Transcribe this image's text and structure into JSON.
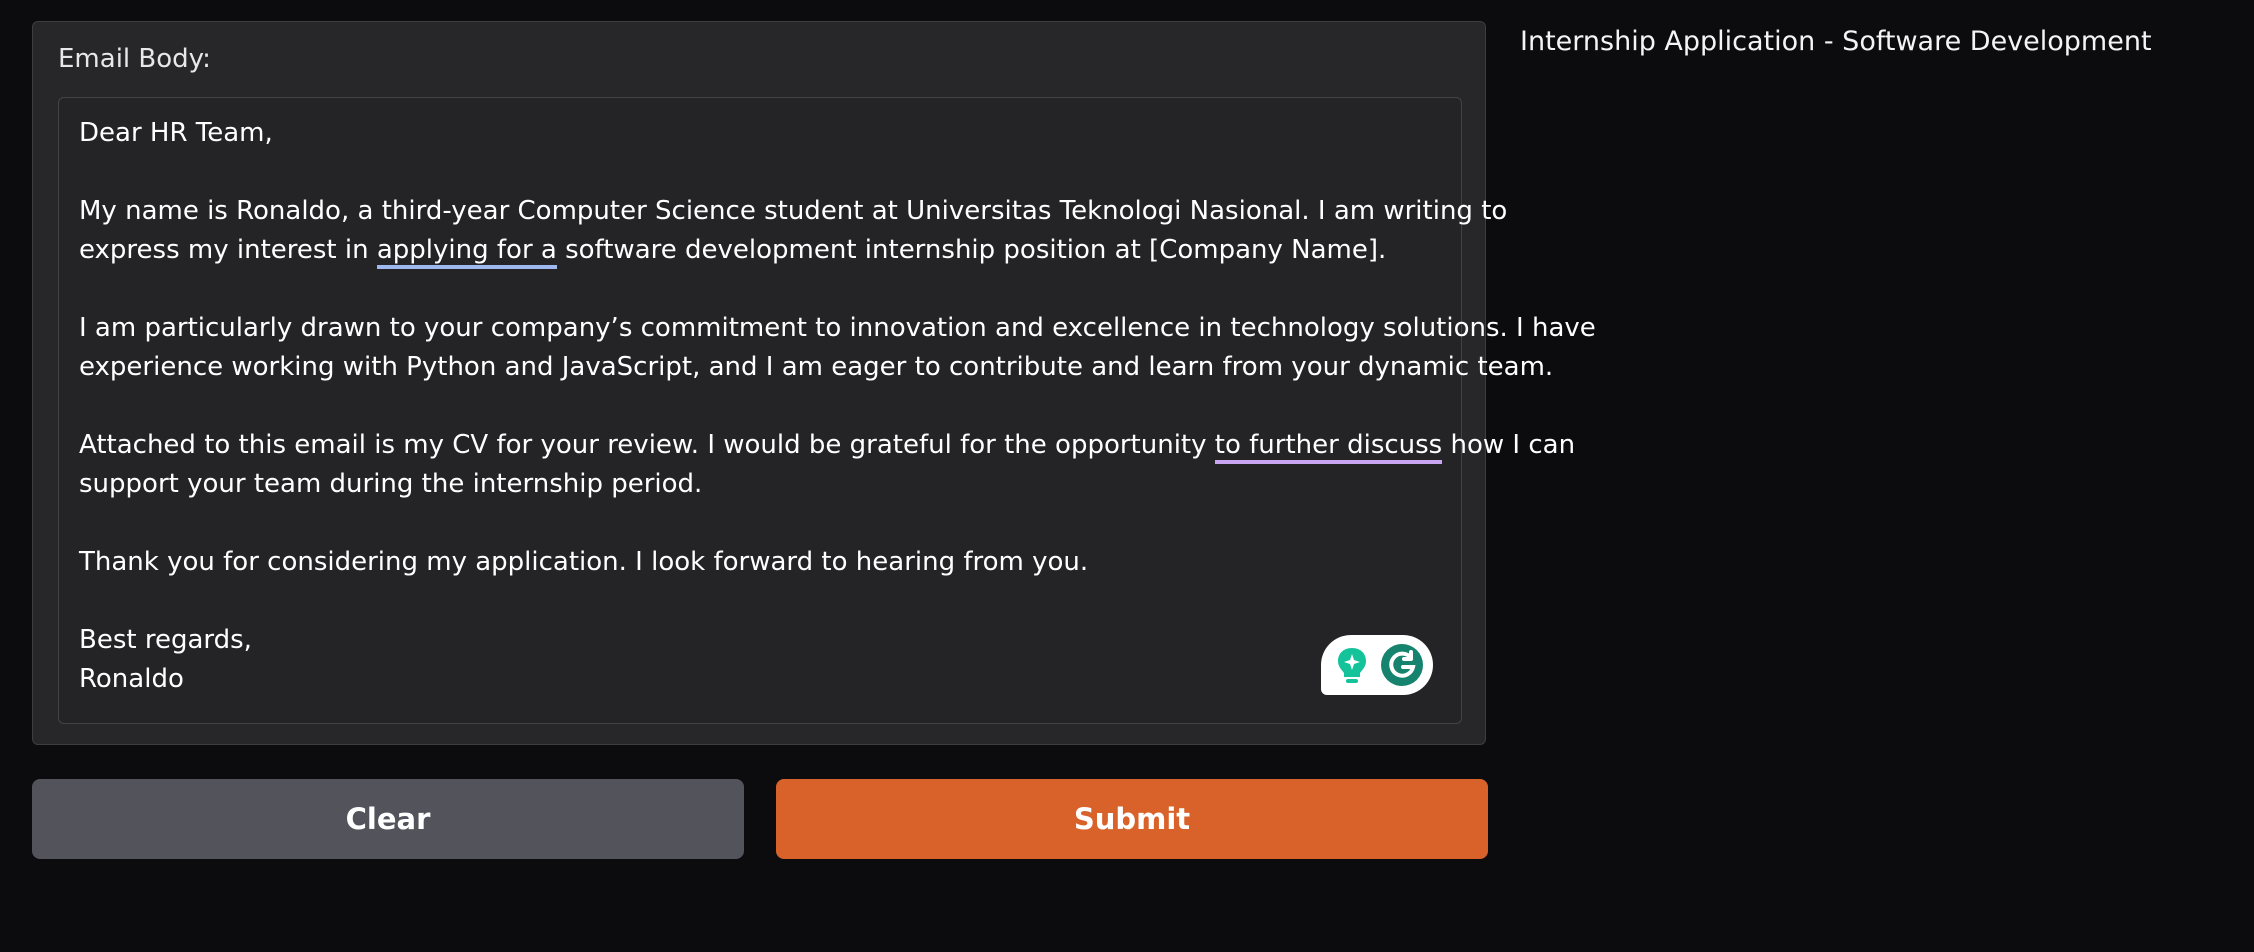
{
  "email_panel": {
    "label": "Email Body:",
    "body": {
      "greeting": "Dear HR Team,",
      "p1_l1": "My name is Ronaldo, a third-year Computer Science student at Universitas Teknologi Nasional. I am writing to",
      "p1_l2_pre": "express my interest in ",
      "p1_l2_flag": "applying for a",
      "p1_l2_post": " software development internship position at [Company Name].",
      "p2_l1": "I am particularly drawn to your company’s commitment to innovation and excellence in technology solutions. I have",
      "p2_l2": "experience working with Python and JavaScript, and I am eager to contribute and learn from your dynamic team.",
      "p3_l1_pre": "Attached to this email is my CV for your review. I would be grateful for the opportunity ",
      "p3_l1_flag": "to further discuss",
      "p3_l1_post": " how I can",
      "p3_l2": "support your team during the internship period.",
      "p4": "Thank you for considering my application. I look forward to hearing from you.",
      "closing": "Best regards,",
      "signature": "Ronaldo"
    },
    "grammarly": {
      "icons": [
        "lightbulb-icon",
        "grammarly-logo-icon"
      ],
      "colors": {
        "brand": "#15836e",
        "bulb": "#15c39a"
      }
    }
  },
  "buttons": {
    "clear_label": "Clear",
    "submit_label": "Submit"
  },
  "subject_output": "Internship Application - Software Development",
  "colors": {
    "background": "#0c0c0e",
    "panel": "#27272a",
    "clear_button": "#52535b",
    "submit_button": "#d9622b",
    "underline_clarity": "#9fb8f0",
    "underline_delivery": "#c9a5f2"
  }
}
